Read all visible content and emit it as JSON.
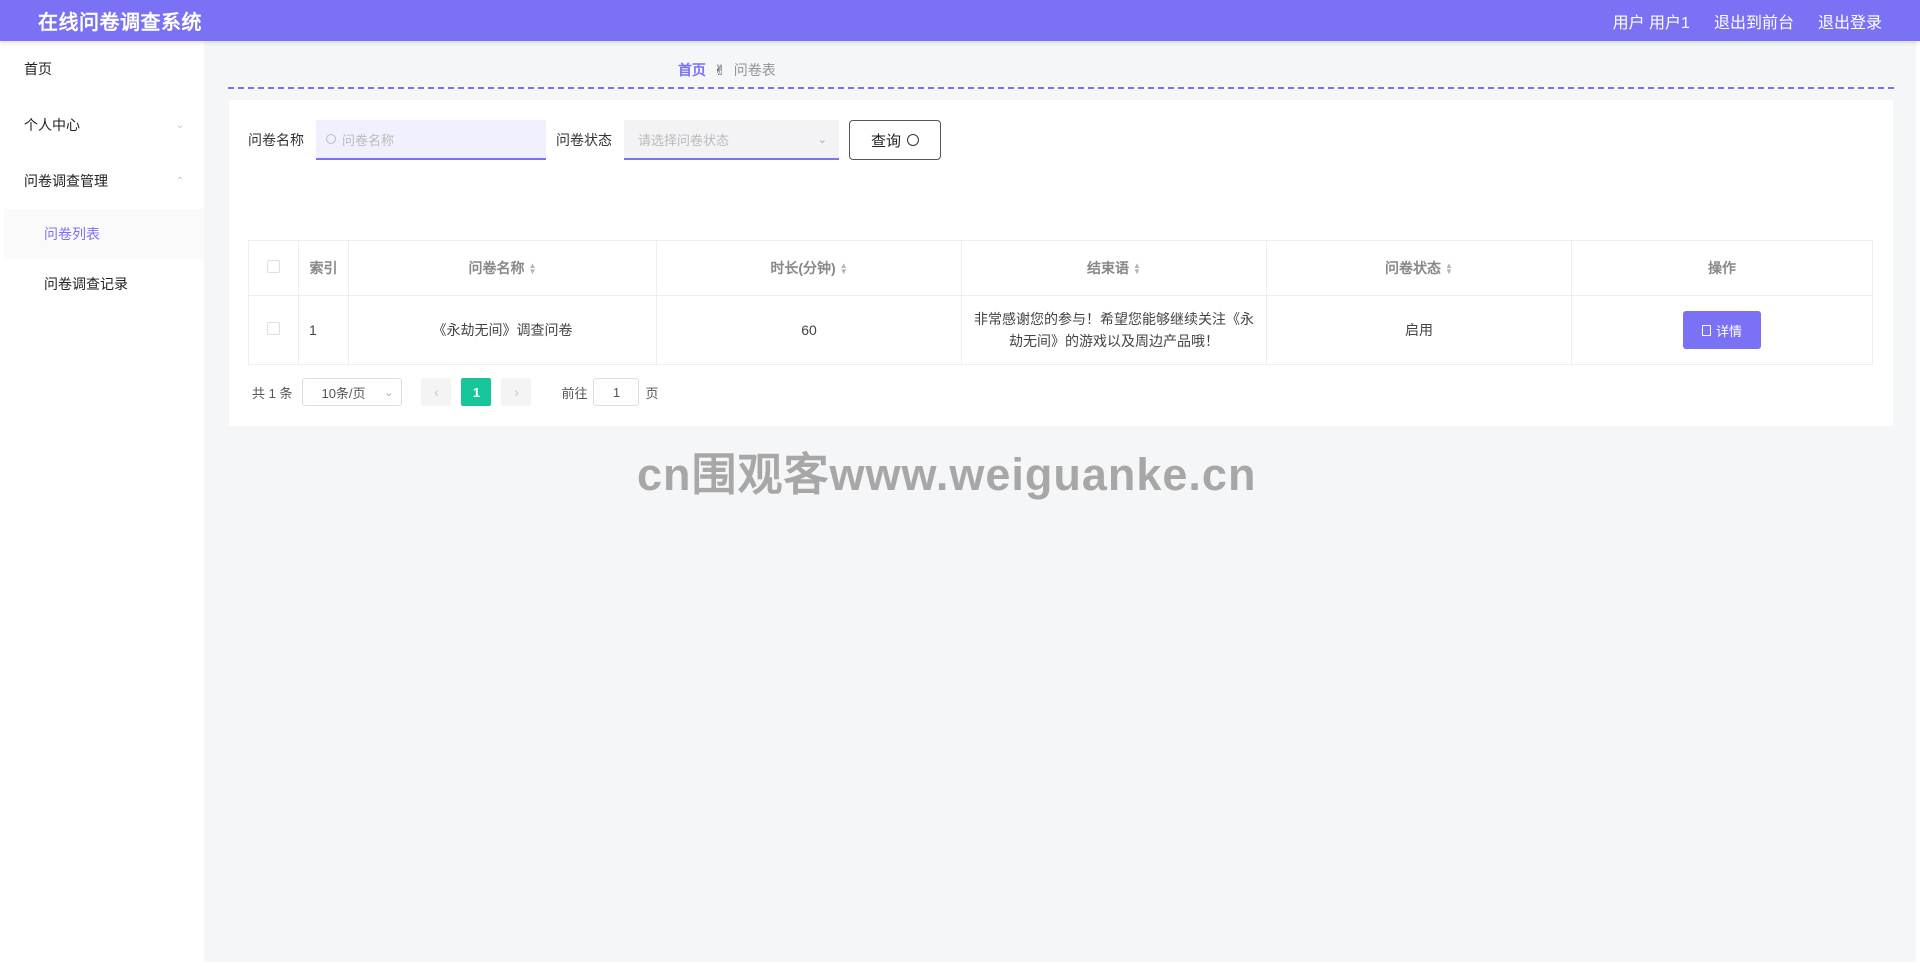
{
  "header": {
    "title": "在线问卷调查系统",
    "user_text": "用户 用户1",
    "front_link": "退出到前台",
    "logout_link": "退出登录"
  },
  "sidebar": {
    "items": [
      {
        "label": "首页"
      },
      {
        "label": "个人中心",
        "chevron": "chevron-down-icon"
      },
      {
        "label": "问卷调查管理",
        "chevron": "chevron-up-icon"
      }
    ],
    "sub_items": [
      {
        "label": "问卷列表",
        "active": true
      },
      {
        "label": "问卷调查记录",
        "active": false
      }
    ]
  },
  "breadcrumb": {
    "home": "首页",
    "separator_icon": "hand-icon",
    "current": "问卷表"
  },
  "search": {
    "name_label": "问卷名称",
    "name_placeholder": "问卷名称",
    "status_label": "问卷状态",
    "status_placeholder": "请选择问卷状态",
    "button_label": "查询"
  },
  "table": {
    "headers": [
      "索引",
      "问卷名称",
      "时长(分钟)",
      "结束语",
      "问卷状态",
      "操作"
    ],
    "rows": [
      {
        "index": "1",
        "name": "《永劫无间》调查问卷",
        "duration": "60",
        "ending": "非常感谢您的参与！希望您能够继续关注《永劫无间》的游戏以及周边产品哦！",
        "status": "启用",
        "action": "详情"
      }
    ]
  },
  "pagination": {
    "total": "共 1 条",
    "page_size": "10条/页",
    "current_page": "1",
    "goto_label": "前往",
    "goto_value": "1",
    "page_suffix": "页"
  },
  "watermark": "cn围观客www.weiguanke.cn",
  "colors": {
    "accent": "#7a71f5",
    "page_active": "#16c59a"
  }
}
